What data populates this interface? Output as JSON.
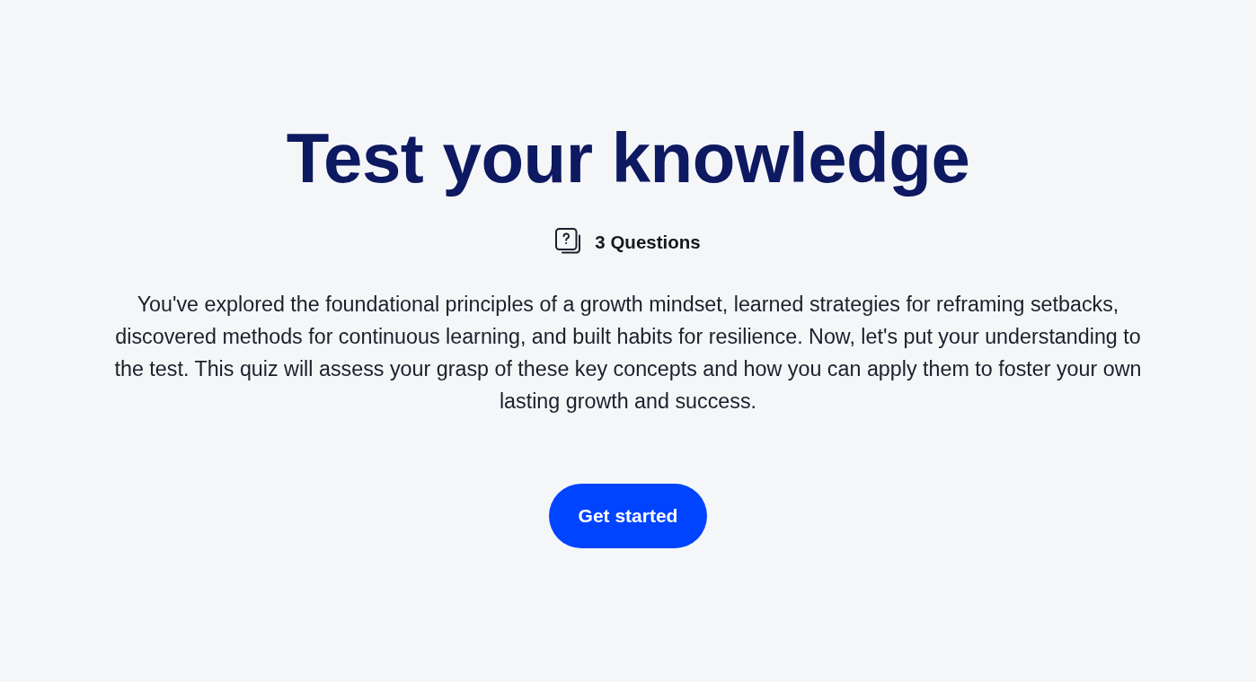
{
  "title": "Test your knowledge",
  "meta": {
    "count_label": "3 Questions"
  },
  "description": "You've explored the foundational principles of a growth mindset, learned strategies for reframing setbacks, discovered methods for continuous learning, and built habits for resilience. Now, let's put your understanding to the test. This quiz will assess your grasp of these key concepts and how you can apply them to foster your own lasting growth and success.",
  "button": {
    "label": "Get started"
  }
}
